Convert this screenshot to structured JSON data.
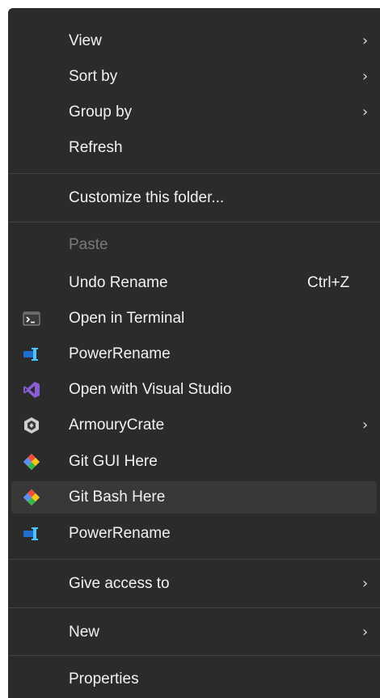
{
  "menu": {
    "items": [
      {
        "label": "View",
        "submenu": true
      },
      {
        "label": "Sort by",
        "submenu": true
      },
      {
        "label": "Group by",
        "submenu": true
      },
      {
        "label": "Refresh"
      },
      {
        "label": "Customize this folder..."
      },
      {
        "label": "Paste",
        "disabled": true
      },
      {
        "label": "Undo Rename",
        "shortcut": "Ctrl+Z"
      },
      {
        "label": "Open in Terminal",
        "icon": "terminal-icon"
      },
      {
        "label": "PowerRename",
        "icon": "powerrename-icon"
      },
      {
        "label": "Open with Visual Studio",
        "icon": "visual-studio-icon"
      },
      {
        "label": "ArmouryCrate",
        "icon": "armourycrate-icon",
        "submenu": true
      },
      {
        "label": "Git GUI Here",
        "icon": "git-icon"
      },
      {
        "label": "Git Bash Here",
        "icon": "git-icon",
        "hovered": true
      },
      {
        "label": "PowerRename",
        "icon": "powerrename-icon"
      },
      {
        "label": "Give access to",
        "submenu": true
      },
      {
        "label": "New",
        "submenu": true
      },
      {
        "label": "Properties"
      }
    ],
    "chevron_glyph": "›"
  },
  "colors": {
    "menu_background": "#2b2b2b",
    "hover_background": "#383838",
    "text": "#f2f2f2",
    "disabled_text": "#7a7a7a",
    "separator": "#444444"
  }
}
